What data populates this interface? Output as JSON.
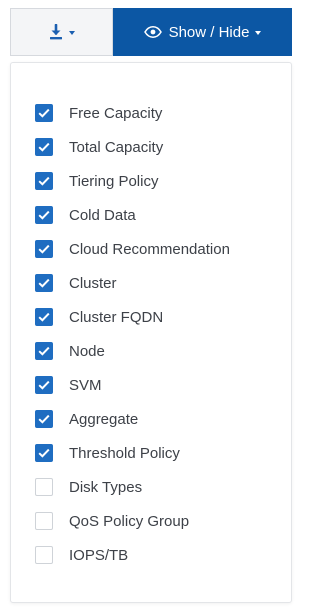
{
  "toolbar": {
    "download_icon": "download-icon",
    "show_hide_icon": "eye-icon",
    "show_hide_label": "Show / Hide",
    "accent_color": "#0c57a4"
  },
  "columns": [
    {
      "label": "Free Capacity",
      "checked": true
    },
    {
      "label": "Total Capacity",
      "checked": true
    },
    {
      "label": "Tiering Policy",
      "checked": true
    },
    {
      "label": "Cold Data",
      "checked": true
    },
    {
      "label": "Cloud Recommendation",
      "checked": true
    },
    {
      "label": "Cluster",
      "checked": true
    },
    {
      "label": "Cluster FQDN",
      "checked": true
    },
    {
      "label": "Node",
      "checked": true
    },
    {
      "label": "SVM",
      "checked": true
    },
    {
      "label": "Aggregate",
      "checked": true
    },
    {
      "label": "Threshold Policy",
      "checked": true
    },
    {
      "label": "Disk Types",
      "checked": false
    },
    {
      "label": "QoS Policy Group",
      "checked": false
    },
    {
      "label": "IOPS/TB",
      "checked": false
    }
  ],
  "colors": {
    "checkbox_checked": "#1f6dc1",
    "checkbox_unchecked_border": "#cfd3d8"
  }
}
